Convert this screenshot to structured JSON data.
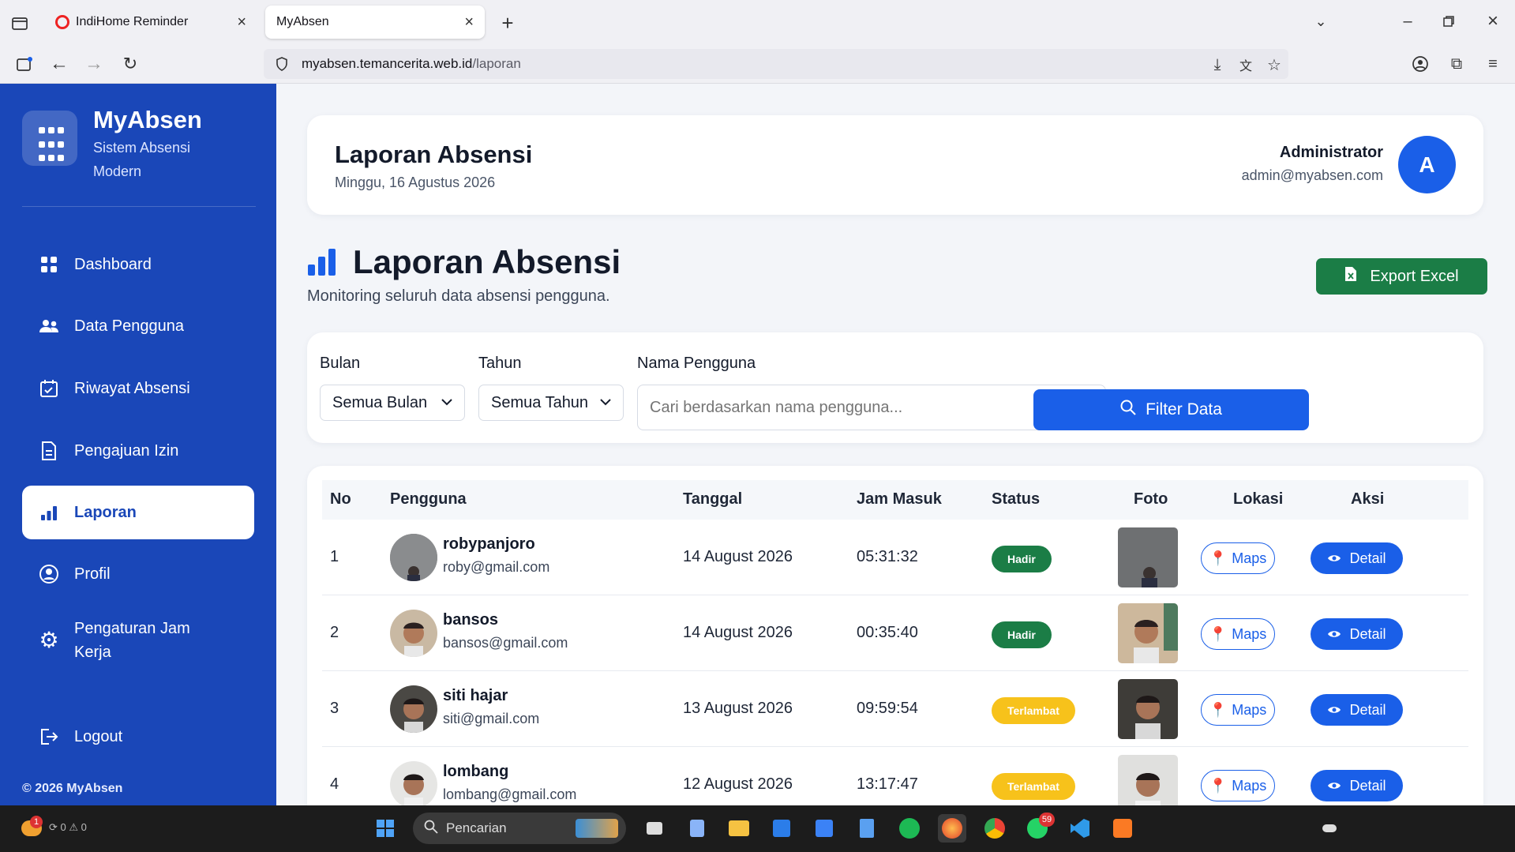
{
  "browser": {
    "tabs": [
      {
        "title": "IndiHome Reminder"
      },
      {
        "title": "MyAbsen"
      }
    ],
    "url_domain": "myabsen.temancerita.web.id",
    "url_path": "/laporan"
  },
  "sidebar": {
    "brand": "MyAbsen",
    "subtitle": "Sistem Absensi Modern",
    "items": [
      {
        "label": "Dashboard",
        "icon": "grid-icon"
      },
      {
        "label": "Data Pengguna",
        "icon": "users-icon"
      },
      {
        "label": "Riwayat Absensi",
        "icon": "calendar-check-icon"
      },
      {
        "label": "Pengajuan Izin",
        "icon": "document-icon"
      },
      {
        "label": "Laporan",
        "icon": "bar-chart-icon",
        "active": true
      },
      {
        "label": "Profil",
        "icon": "user-circle-icon"
      },
      {
        "label": "Pengaturan Jam Kerja",
        "icon": "gear-icon"
      }
    ],
    "logout": "Logout",
    "footer": "© 2026 MyAbsen"
  },
  "header": {
    "title": "Laporan Absensi",
    "date": "Minggu, 16 Agustus 2026",
    "user_name": "Administrator",
    "user_email": "admin@myabsen.com",
    "avatar_letter": "A"
  },
  "page": {
    "title": "Laporan Absensi",
    "subtitle": "Monitoring seluruh data absensi pengguna.",
    "export_label": "Export Excel"
  },
  "filter": {
    "month_label": "Bulan",
    "month_value": "Semua Bulan",
    "year_label": "Tahun",
    "year_value": "Semua Tahun",
    "name_label": "Nama Pengguna",
    "name_placeholder": "Cari berdasarkan nama pengguna...",
    "button_label": "Filter Data"
  },
  "table": {
    "columns": [
      "No",
      "Pengguna",
      "Tanggal",
      "Jam Masuk",
      "Status",
      "Foto",
      "Lokasi",
      "Aksi"
    ],
    "maps_label": "Maps",
    "detail_label": "Detail",
    "rows": [
      {
        "no": "1",
        "name": "robypanjoro",
        "email": "roby@gmail.com",
        "date": "14 August 2026",
        "time": "05:31:32",
        "status": "Hadir"
      },
      {
        "no": "2",
        "name": "bansos",
        "email": "bansos@gmail.com",
        "date": "14 August 2026",
        "time": "00:35:40",
        "status": "Hadir"
      },
      {
        "no": "3",
        "name": "siti hajar",
        "email": "siti@gmail.com",
        "date": "13 August 2026",
        "time": "09:59:54",
        "status": "Terlambat"
      },
      {
        "no": "4",
        "name": "lombang",
        "email": "lombang@gmail.com",
        "date": "12 August 2026",
        "time": "13:17:47",
        "status": "Terlambat"
      }
    ]
  },
  "taskbar": {
    "search_placeholder": "Pencarian",
    "notification_count": "1",
    "whatsapp_count": "59",
    "status_counts": [
      "0",
      "0"
    ]
  },
  "colors": {
    "sidebar": "#1a47b8",
    "primary": "#1a5fe8",
    "success": "#1b7d46",
    "warning": "#f7c21b"
  }
}
